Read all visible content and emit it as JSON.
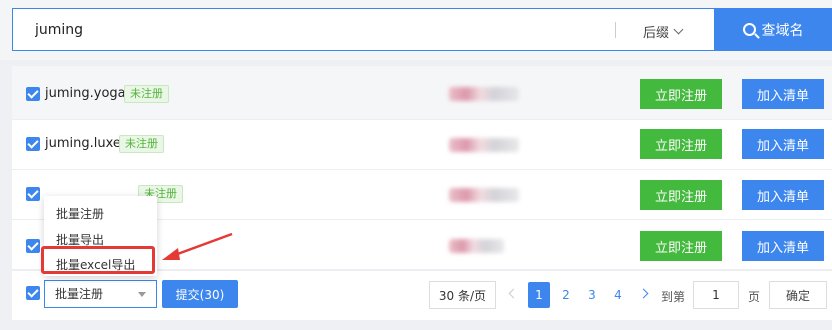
{
  "search": {
    "value": "juming",
    "suffix_label": "后缀",
    "button_label": "查域名"
  },
  "rows": [
    {
      "domain": "juming.yoga",
      "status": "未注册",
      "register_label": "立即注册",
      "add_label": "加入清单"
    },
    {
      "domain": "juming.luxe",
      "status": "未注册",
      "register_label": "立即注册",
      "add_label": "加入清单"
    },
    {
      "domain": "",
      "status": "未注册",
      "register_label": "立即注册",
      "add_label": "加入清单"
    },
    {
      "domain": "",
      "status": "",
      "register_label": "立即注册",
      "add_label": "加入清单"
    }
  ],
  "bulk": {
    "selected": "批量注册",
    "submit_label": "提交(30)",
    "options": [
      "批量注册",
      "批量导出",
      "批量excel导出"
    ]
  },
  "pagination": {
    "per_page": "30 条/页",
    "pages": [
      "1",
      "2",
      "3",
      "4"
    ],
    "current": "1",
    "goto_label": "到第",
    "goto_value": "1",
    "page_unit": "页",
    "confirm_label": "确定"
  },
  "colors": {
    "accent": "#3d86ee",
    "register_green": "#43b93d",
    "status_green": "#52b43b",
    "highlight_red": "#e53935"
  }
}
